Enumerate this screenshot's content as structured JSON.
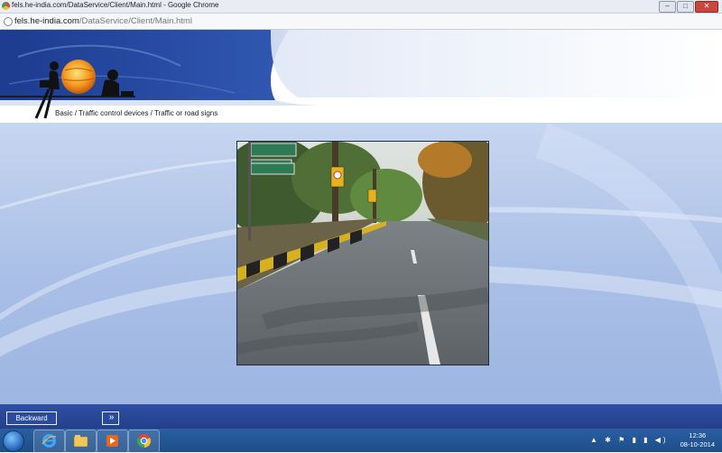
{
  "browser": {
    "window_title": "fels.he-india.com/DataService/Client/Main.html - Google Chrome",
    "url_domain": "fels.he-india.com",
    "url_path": "/DataService/Client/Main.html",
    "window_buttons": {
      "minimize": "–",
      "maximize": "□",
      "close": "✕"
    }
  },
  "page": {
    "breadcrumb": "Basic  /  Traffic control devices  /  Traffic or road signs"
  },
  "navigation": {
    "backward_label": "Backward",
    "forward_label": "»"
  },
  "taskbar": {
    "pinned_apps": [
      "internet-explorer",
      "file-explorer",
      "media-player",
      "google-chrome"
    ],
    "clock_time": "12:36",
    "clock_date": "08-10-2014"
  },
  "colors": {
    "header_blue": "#233f94",
    "content_blue": "#a9bfe6",
    "navbar_blue": "#2a4a9c",
    "taskbar_blue": "#1e4d8a"
  }
}
